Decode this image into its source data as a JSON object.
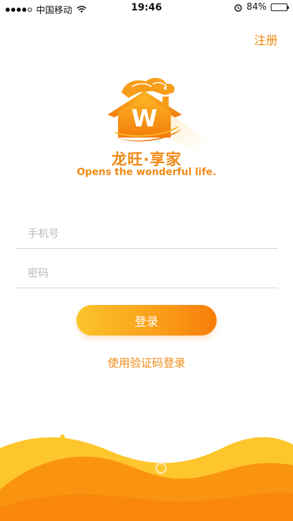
{
  "status_bar": {
    "carrier": "中国移动",
    "time": "19:46",
    "battery": "84%",
    "battery_level": 0.84,
    "icons": [
      "signal-icon",
      "wifi-icon",
      "alarm-icon",
      "battery-icon"
    ]
  },
  "header": {
    "register_label": "注册"
  },
  "brand": {
    "logo_letter": "W",
    "name": "龙旺·享家",
    "slogan": "Opens the wonderful life."
  },
  "form": {
    "phone_placeholder": "手机号",
    "phone_value": "",
    "password_placeholder": "密码",
    "password_value": "",
    "login_label": "登录",
    "sms_login_label": "使用验证码登录"
  },
  "colors": {
    "accent": "#f08a16",
    "gradient_start": "#fbc52d",
    "gradient_end": "#f87d09",
    "wave_light": "#fdc62c",
    "wave_dark": "#fa9410"
  }
}
